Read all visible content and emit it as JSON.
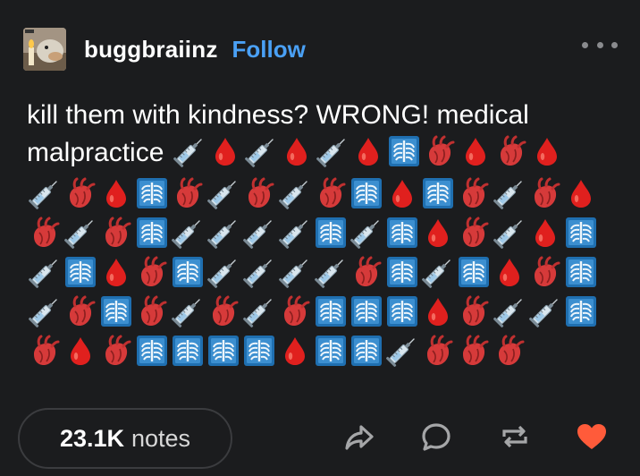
{
  "post": {
    "username": "buggbraiinz",
    "follow_label": "Follow",
    "text": "kill them with kindness? WRONG! medical malpractice",
    "text_line1": "kill them with kindness? WRONG! medical",
    "text_line2": "malpractice"
  },
  "emoji_icons": {
    "S": "syringe-icon",
    "D": "drop-of-blood-icon",
    "H": "anatomical-heart-icon",
    "X": "x-ray-icon"
  },
  "emoji_caption_line": [
    "S",
    "D",
    "S",
    "D",
    "S",
    "D",
    "X",
    "H",
    "D",
    "H",
    "D"
  ],
  "emoji_rows": [
    [
      "S",
      "H",
      "D",
      "X",
      "H",
      "S",
      "H",
      "S",
      "H",
      "X",
      "D",
      "X",
      "H",
      "S",
      "H",
      "D"
    ],
    [
      "H",
      "S",
      "H",
      "X",
      "S",
      "S",
      "S",
      "S",
      "X",
      "S",
      "X",
      "D",
      "H",
      "S",
      "D",
      "X"
    ],
    [
      "S",
      "X",
      "D",
      "H",
      "X",
      "S",
      "S",
      "S",
      "S",
      "H",
      "X",
      "S",
      "X",
      "D",
      "H",
      "X"
    ],
    [
      "S",
      "H",
      "X",
      "H",
      "S",
      "H",
      "S",
      "H",
      "X",
      "X",
      "X",
      "D",
      "H",
      "S",
      "S",
      "X"
    ],
    [
      "H",
      "D",
      "H",
      "X",
      "X",
      "X",
      "X",
      "D",
      "X",
      "X",
      "S",
      "H",
      "H",
      "H"
    ]
  ],
  "footer": {
    "notes_count": "23.1K",
    "notes_label": "notes"
  },
  "colors": {
    "background": "#1b1c1e",
    "follow": "#4aa0f5",
    "like": "#ff5b3a",
    "icon_gray": "#a5a6a8"
  }
}
